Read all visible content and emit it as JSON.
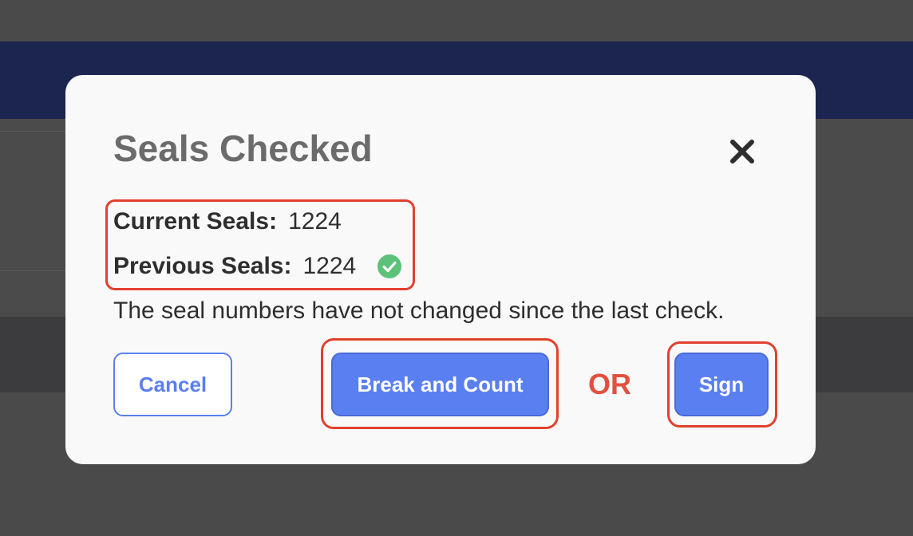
{
  "modal": {
    "title": "Seals Checked",
    "current_seals_label": "Current Seals:",
    "current_seals_value": "1224",
    "previous_seals_label": "Previous Seals:",
    "previous_seals_value": "1224",
    "match_status_icon": "check-circle-icon",
    "message": "The seal numbers have not changed since the last check.",
    "close_icon": "close-icon"
  },
  "actions": {
    "cancel_label": "Cancel",
    "break_and_count_label": "Break and Count",
    "or_label": "OR",
    "sign_label": "Sign"
  },
  "colors": {
    "primary": "#5a7ff0",
    "annotation": "#e2402e",
    "success": "#5cc27a",
    "header": "#1b2550",
    "title": "#6b6b6b"
  }
}
